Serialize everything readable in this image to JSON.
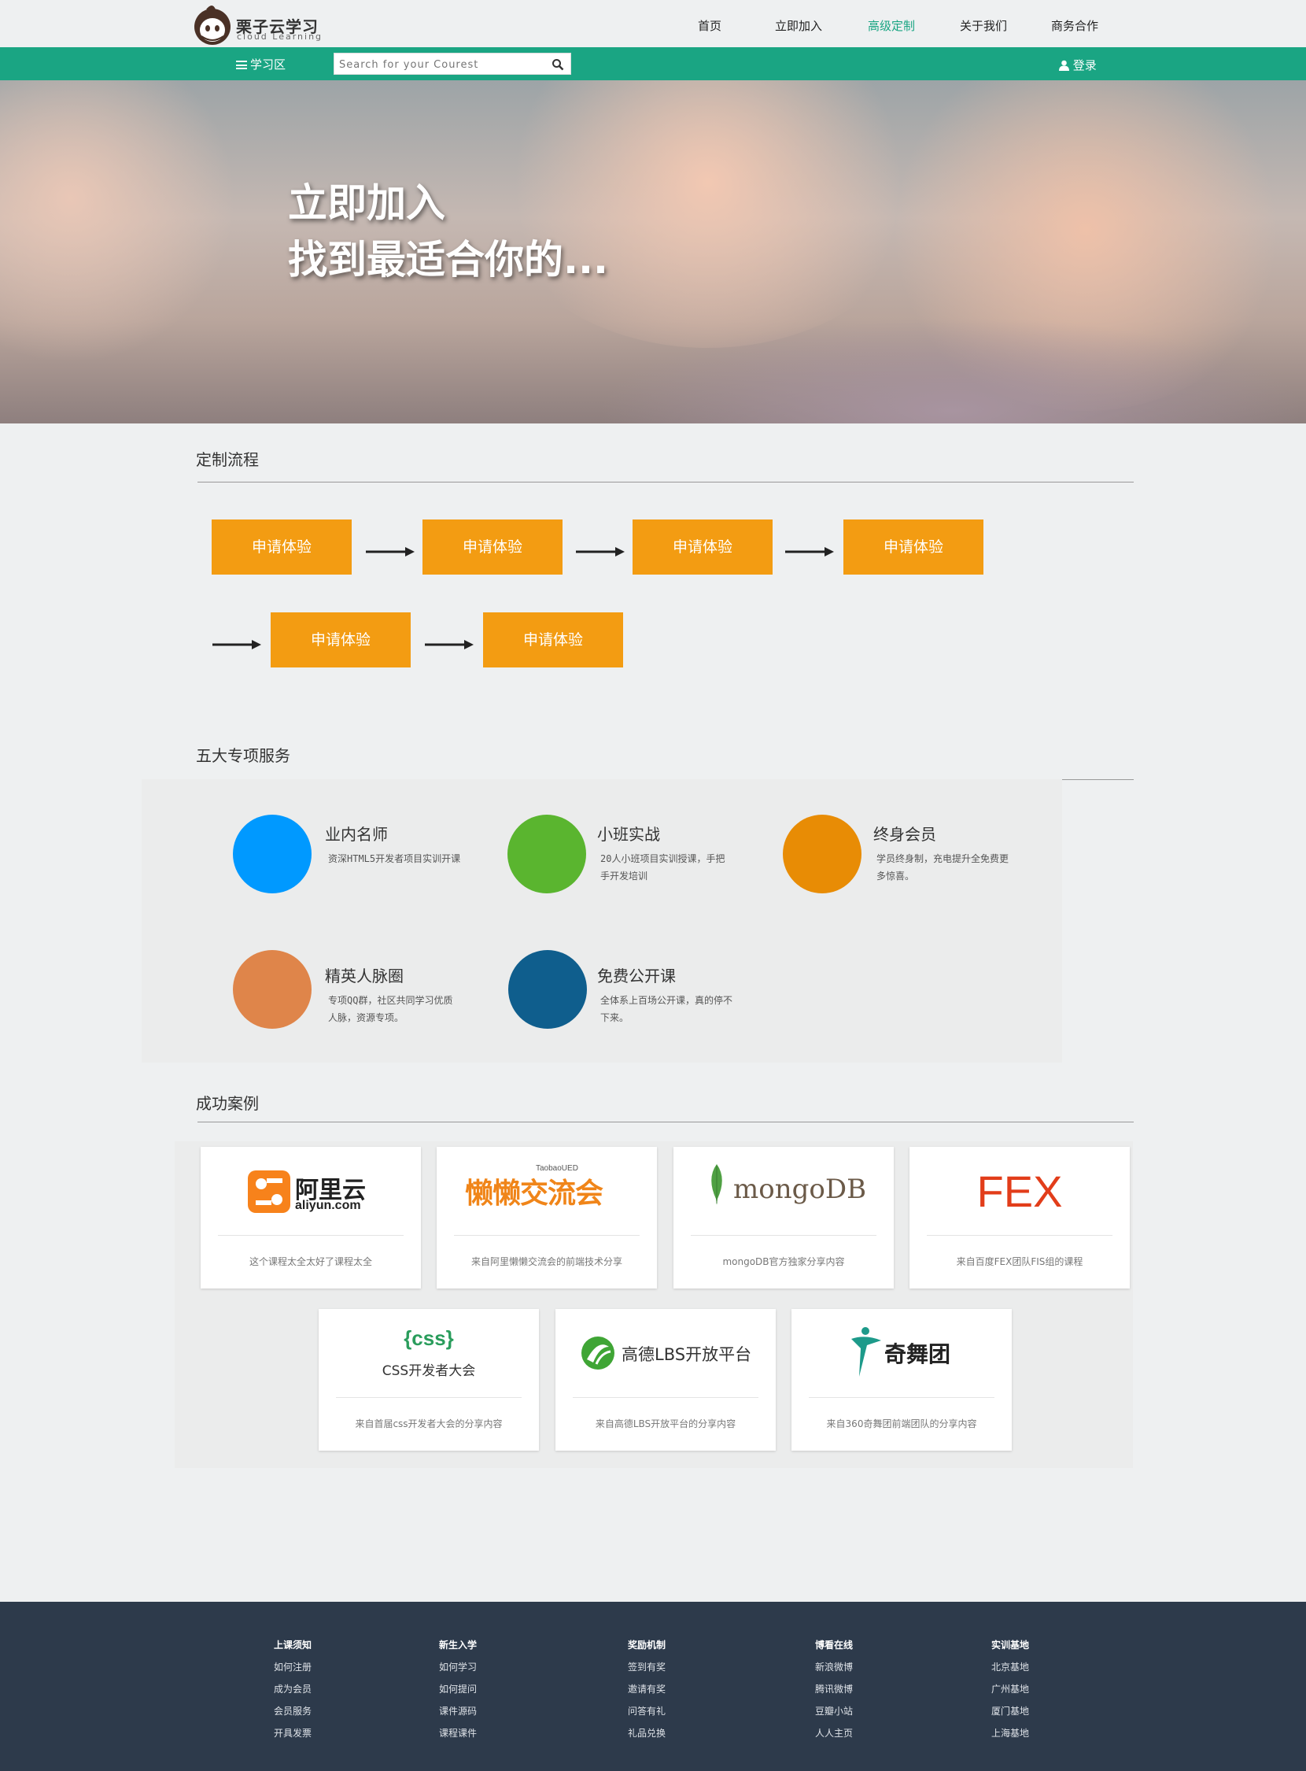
{
  "brand": {
    "title": "栗子云学习",
    "subtitle": "cloud Learning"
  },
  "nav": [
    {
      "label": "首页",
      "active": false
    },
    {
      "label": "立即加入",
      "active": false
    },
    {
      "label": "高级定制",
      "active": true
    },
    {
      "label": "关于我们",
      "active": false
    },
    {
      "label": "商务合作",
      "active": false
    }
  ],
  "toolbar": {
    "menu_label": "学习区",
    "search_placeholder": "Search for your Courest",
    "login_label": "登录"
  },
  "hero": {
    "line1": "立即加入",
    "line2": "找到最适合你的..."
  },
  "process": {
    "title": "定制流程",
    "steps": [
      "申请体验",
      "申请体验",
      "申请体验",
      "申请体验",
      "申请体验",
      "申请体验"
    ]
  },
  "services": {
    "title": "五大专项服务",
    "items": [
      {
        "title": "业内名师",
        "desc": "资深HTML5开发者项目实训开课",
        "color": "#0099ff"
      },
      {
        "title": "小班实战",
        "desc": "20人小班项目实训授课，手把手开发培训",
        "color": "#5ab52f"
      },
      {
        "title": "终身会员",
        "desc": "学员终身制，充电提升全免费更多惊喜。",
        "color": "#e88c05"
      },
      {
        "title": "精英人脉圈",
        "desc": "专项QQ群，社区共同学习优质人脉，资源专项。",
        "color": "#df854a"
      },
      {
        "title": "免费公开课",
        "desc": "全体系上百场公开课，真的停不下来。",
        "color": "#0f5e8d"
      }
    ]
  },
  "cases": {
    "title": "成功案例",
    "items": [
      {
        "logo_text": "阿里云",
        "logo_sub": "aliyun.com",
        "logo_icon": "aliyun-logo",
        "desc": "这个课程太全太好了课程太全"
      },
      {
        "logo_text": "懒懒交流会",
        "logo_sub": "TaobaoUED",
        "logo_icon": "lanlan-logo",
        "desc": "来自阿里懒懒交流会的前端技术分享"
      },
      {
        "logo_text": "mongoDB",
        "logo_icon": "mongodb-logo",
        "desc": "mongoDB官方独家分享内容"
      },
      {
        "logo_text": "FEX",
        "logo_icon": "fex-logo",
        "desc": "来自百度FEX团队FIS组的课程"
      },
      {
        "logo_text": "{css}",
        "logo_sub": "CSS开发者大会",
        "logo_icon": "css-logo",
        "desc": "来自首届css开发者大会的分享内容"
      },
      {
        "logo_text": "高德LBS开放平台",
        "logo_icon": "amap-logo",
        "desc": "来自高德LBS开放平台的分享内容"
      },
      {
        "logo_text": "奇舞团",
        "logo_icon": "qiwutuan-logo",
        "desc": "来自360奇舞团前端团队的分享内容"
      }
    ]
  },
  "footer": {
    "columns": [
      {
        "head": "上课须知",
        "links": [
          "如何注册",
          "成为会员",
          "会员服务",
          "开具发票"
        ]
      },
      {
        "head": "新生入学",
        "links": [
          "如何学习",
          "如何提问",
          "课件源码",
          "课程课件"
        ]
      },
      {
        "head": "奖励机制",
        "links": [
          "签到有奖",
          "邀请有奖",
          "问答有礼",
          "礼品兑换"
        ]
      },
      {
        "head": "博看在线",
        "links": [
          "新浪微博",
          "腾讯微博",
          "豆瓣小站",
          "人人主页"
        ]
      },
      {
        "head": "实训基地",
        "links": [
          "北京基地",
          "广州基地",
          "厦门基地",
          "上海基地"
        ]
      }
    ]
  },
  "colors": {
    "accent": "#1aa583",
    "step": "#f39c12",
    "footer": "#2d3a4b"
  }
}
